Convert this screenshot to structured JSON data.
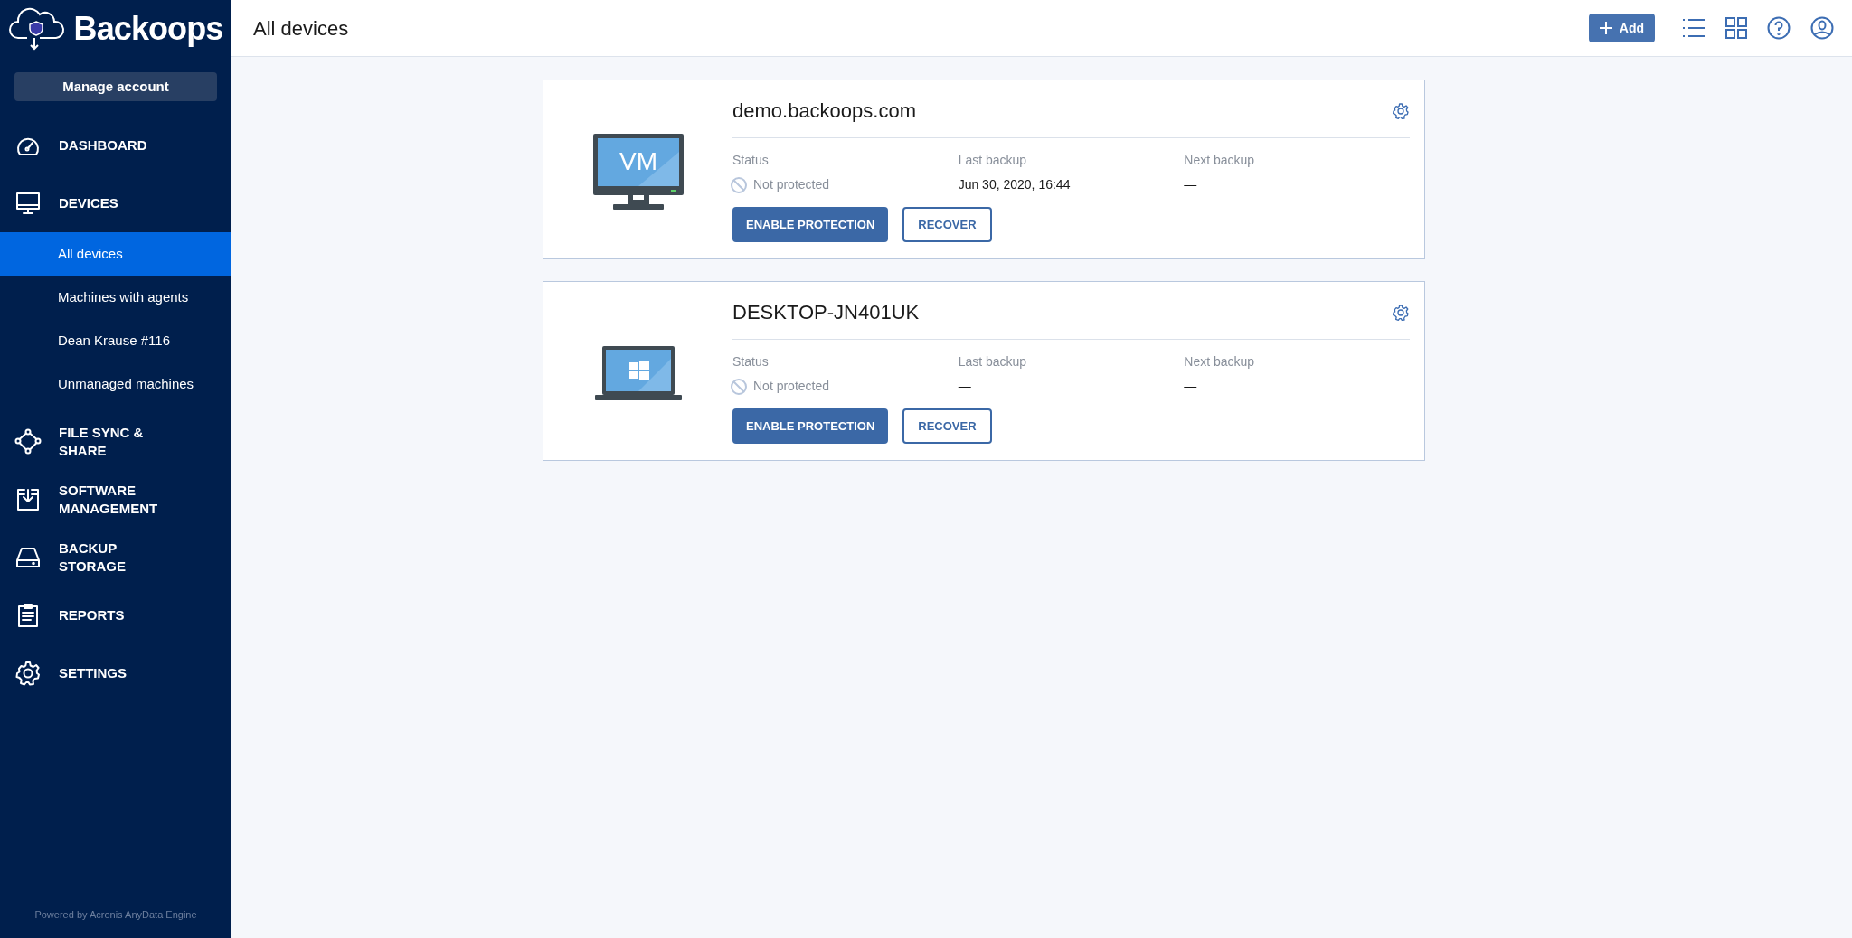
{
  "brand": {
    "name": "Backoops"
  },
  "sidebar": {
    "account_button": "Manage account",
    "items": [
      {
        "kind": "dashboard",
        "label": "DASHBOARD"
      },
      {
        "kind": "devices",
        "label": "DEVICES",
        "children": [
          {
            "label": "All devices",
            "selected": true
          },
          {
            "label": "Machines with agents",
            "selected": false
          },
          {
            "label": "Dean Krause #116",
            "selected": false
          },
          {
            "label": "Unmanaged machines",
            "selected": false
          }
        ]
      },
      {
        "kind": "sync",
        "label": "FILE SYNC & SHARE"
      },
      {
        "kind": "software",
        "label": "SOFTWARE MANAGEMENT"
      },
      {
        "kind": "storage",
        "label": "BACKUP STORAGE"
      },
      {
        "kind": "reports",
        "label": "REPORTS"
      },
      {
        "kind": "settings",
        "label": "SETTINGS"
      }
    ],
    "footer": "Powered by Acronis AnyData Engine"
  },
  "header": {
    "title": "All devices",
    "add_button": "Add"
  },
  "devices": [
    {
      "kind": "vm",
      "screen_text": "VM",
      "name": "demo.backoops.com",
      "status_label": "Status",
      "status": "Not protected",
      "last_backup_label": "Last backup",
      "last_backup": "Jun 30, 2020, 16:44",
      "next_backup_label": "Next backup",
      "next_backup": "—",
      "buttons": [
        "ENABLE PROTECTION",
        "RECOVER"
      ]
    },
    {
      "kind": "laptop",
      "name": "DESKTOP-JN401UK",
      "status_label": "Status",
      "status": "Not protected",
      "last_backup_label": "Last backup",
      "last_backup": "—",
      "next_backup_label": "Next backup",
      "next_backup": "—",
      "buttons": [
        "ENABLE PROTECTION",
        "RECOVER"
      ]
    }
  ]
}
